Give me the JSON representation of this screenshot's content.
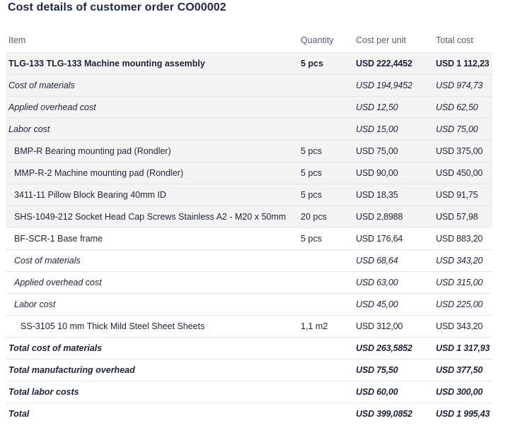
{
  "title": "Cost details of customer order CO00002",
  "columns": {
    "item": "Item",
    "quantity": "Quantity",
    "cost_per_unit": "Cost per unit",
    "total_cost": "Total cost"
  },
  "rows": [
    {
      "item": "TLG-133 TLG-133 Machine mounting assembly",
      "quantity": "5 pcs",
      "cost_per_unit": "USD 222,4452",
      "total_cost": "USD 1 112,23"
    },
    {
      "item": "Cost of materials",
      "quantity": "",
      "cost_per_unit": "USD 194,9452",
      "total_cost": "USD 974,73"
    },
    {
      "item": "Applied overhead cost",
      "quantity": "",
      "cost_per_unit": "USD 12,50",
      "total_cost": "USD 62,50"
    },
    {
      "item": "Labor cost",
      "quantity": "",
      "cost_per_unit": "USD 15,00",
      "total_cost": "USD 75,00"
    },
    {
      "item": "BMP-R Bearing mounting pad (Rondler)",
      "quantity": "5 pcs",
      "cost_per_unit": "USD 75,00",
      "total_cost": "USD 375,00"
    },
    {
      "item": "MMP-R-2 Machine mounting pad (Rondler)",
      "quantity": "5 pcs",
      "cost_per_unit": "USD 90,00",
      "total_cost": "USD 450,00"
    },
    {
      "item": "3411-11 Pillow Block Bearing 40mm ID",
      "quantity": "5 pcs",
      "cost_per_unit": "USD 18,35",
      "total_cost": "USD 91,75"
    },
    {
      "item": "SHS-1049-212 Socket Head Cap Screws Stainless A2 - M20 x 50mm",
      "quantity": "20 pcs",
      "cost_per_unit": "USD 2,8988",
      "total_cost": "USD 57,98"
    },
    {
      "item": "BF-SCR-1 Base frame",
      "quantity": "5 pcs",
      "cost_per_unit": "USD 176,64",
      "total_cost": "USD 883,20"
    },
    {
      "item": "Cost of materials",
      "quantity": "",
      "cost_per_unit": "USD 68,64",
      "total_cost": "USD 343,20"
    },
    {
      "item": "Applied overhead cost",
      "quantity": "",
      "cost_per_unit": "USD 63,00",
      "total_cost": "USD 315,00"
    },
    {
      "item": "Labor cost",
      "quantity": "",
      "cost_per_unit": "USD 45,00",
      "total_cost": "USD 225,00"
    },
    {
      "item": "SS-3105 10 mm Thick Mild Steel Sheet Sheets",
      "quantity": "1,1 m2",
      "cost_per_unit": "USD 312,00",
      "total_cost": "USD 343,20"
    },
    {
      "item": "Total cost of materials",
      "quantity": "",
      "cost_per_unit": "USD 263,5852",
      "total_cost": "USD 1 317,93"
    },
    {
      "item": "Total manufacturing overhead",
      "quantity": "",
      "cost_per_unit": "USD 75,50",
      "total_cost": "USD 377,50"
    },
    {
      "item": "Total labor costs",
      "quantity": "",
      "cost_per_unit": "USD 60,00",
      "total_cost": "USD 300,00"
    },
    {
      "item": "Total",
      "quantity": "",
      "cost_per_unit": "USD 399,0852",
      "total_cost": "USD 1 995,43"
    }
  ]
}
